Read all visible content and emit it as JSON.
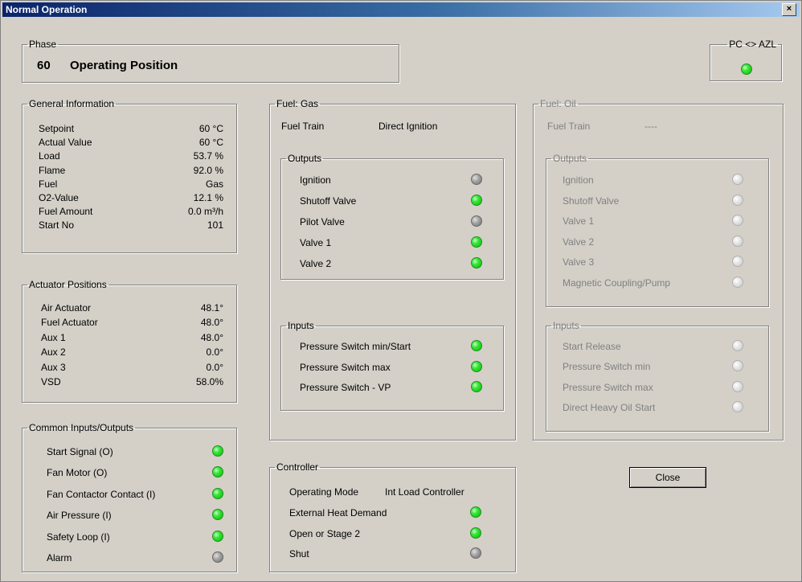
{
  "window": {
    "title": "Normal Operation",
    "close_glyph": "×"
  },
  "phase": {
    "legend": "Phase",
    "number": "60",
    "name": "Operating Position"
  },
  "pc_azl": {
    "legend": "PC <> AZL",
    "state": "on"
  },
  "general_info": {
    "legend": "General Information",
    "rows": [
      {
        "label": "Setpoint",
        "value": "60 °C"
      },
      {
        "label": "Actual Value",
        "value": "60 °C"
      },
      {
        "label": "Load",
        "value": "53.7 %"
      },
      {
        "label": "Flame",
        "value": "92.0 %"
      },
      {
        "label": "Fuel",
        "value": "Gas"
      },
      {
        "label": "O2-Value",
        "value": "12.1 %"
      },
      {
        "label": "Fuel Amount",
        "value": "0.0 m³/h"
      },
      {
        "label": "Start No",
        "value": "101"
      }
    ]
  },
  "actuators": {
    "legend": "Actuator Positions",
    "rows": [
      {
        "label": "Air Actuator",
        "value": "48.1°"
      },
      {
        "label": "Fuel Actuator",
        "value": "48.0°"
      },
      {
        "label": "Aux 1",
        "value": "48.0°"
      },
      {
        "label": "Aux 2",
        "value": "0.0°"
      },
      {
        "label": "Aux 3",
        "value": "0.0°"
      },
      {
        "label": "VSD",
        "value": "58.0%"
      }
    ]
  },
  "common_io": {
    "legend": "Common Inputs/Outputs",
    "rows": [
      {
        "label": "Start Signal (O)",
        "state": "on"
      },
      {
        "label": "Fan Motor (O)",
        "state": "on"
      },
      {
        "label": "Fan Contactor Contact (I)",
        "state": "on"
      },
      {
        "label": "Air Pressure (I)",
        "state": "on"
      },
      {
        "label": "Safety Loop (I)",
        "state": "on"
      },
      {
        "label": "Alarm",
        "state": "off"
      }
    ]
  },
  "fuel_gas": {
    "legend": "Fuel: Gas",
    "train_label": "Fuel Train",
    "train_value": "Direct Ignition",
    "outputs": {
      "legend": "Outputs",
      "rows": [
        {
          "label": "Ignition",
          "state": "off"
        },
        {
          "label": "Shutoff Valve",
          "state": "on"
        },
        {
          "label": "Pilot Valve",
          "state": "off"
        },
        {
          "label": "Valve 1",
          "state": "on"
        },
        {
          "label": "Valve 2",
          "state": "on"
        }
      ]
    },
    "inputs": {
      "legend": "Inputs",
      "rows": [
        {
          "label": "Pressure Switch min/Start",
          "state": "on"
        },
        {
          "label": "Pressure Switch max",
          "state": "on"
        },
        {
          "label": "Pressure Switch - VP",
          "state": "on"
        }
      ]
    }
  },
  "fuel_oil": {
    "legend": "Fuel: Oil",
    "train_label": "Fuel Train",
    "train_value": "----",
    "outputs": {
      "legend": "Outputs",
      "rows": [
        {
          "label": "Ignition",
          "state": "dis"
        },
        {
          "label": "Shutoff Valve",
          "state": "dis"
        },
        {
          "label": "Valve 1",
          "state": "dis"
        },
        {
          "label": "Valve 2",
          "state": "dis"
        },
        {
          "label": "Valve 3",
          "state": "dis"
        },
        {
          "label": "Magnetic Coupling/Pump",
          "state": "dis"
        }
      ]
    },
    "inputs": {
      "legend": "Inputs",
      "rows": [
        {
          "label": "Start Release",
          "state": "dis"
        },
        {
          "label": "Pressure Switch min",
          "state": "dis"
        },
        {
          "label": "Pressure Switch max",
          "state": "dis"
        },
        {
          "label": "Direct Heavy Oil Start",
          "state": "dis"
        }
      ]
    }
  },
  "controller": {
    "legend": "Controller",
    "mode_label": "Operating Mode",
    "mode_value": "Int Load Controller",
    "rows": [
      {
        "label": "External Heat Demand",
        "state": "on"
      },
      {
        "label": "Open or Stage 2",
        "state": "on"
      },
      {
        "label": "Shut",
        "state": "off"
      }
    ]
  },
  "buttons": {
    "close_label": "Close"
  },
  "colors": {
    "titlebar_start": "#0a246a",
    "led_on": "#00c000",
    "led_off": "#a0a0a0",
    "face": "#d4d0c8"
  }
}
